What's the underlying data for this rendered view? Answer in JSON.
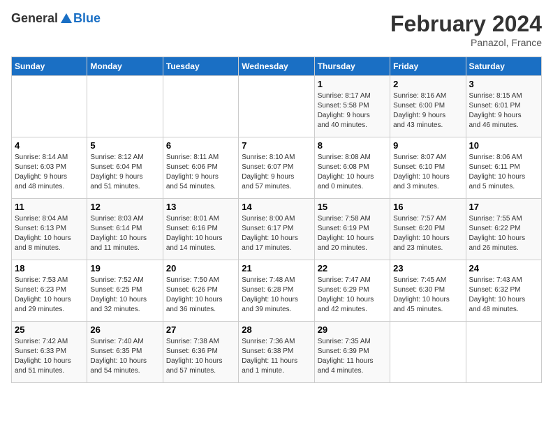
{
  "header": {
    "logo_general": "General",
    "logo_blue": "Blue",
    "month_year": "February 2024",
    "location": "Panazol, France"
  },
  "columns": [
    "Sunday",
    "Monday",
    "Tuesday",
    "Wednesday",
    "Thursday",
    "Friday",
    "Saturday"
  ],
  "weeks": [
    [
      {
        "day": "",
        "info": ""
      },
      {
        "day": "",
        "info": ""
      },
      {
        "day": "",
        "info": ""
      },
      {
        "day": "",
        "info": ""
      },
      {
        "day": "1",
        "info": "Sunrise: 8:17 AM\nSunset: 5:58 PM\nDaylight: 9 hours\nand 40 minutes."
      },
      {
        "day": "2",
        "info": "Sunrise: 8:16 AM\nSunset: 6:00 PM\nDaylight: 9 hours\nand 43 minutes."
      },
      {
        "day": "3",
        "info": "Sunrise: 8:15 AM\nSunset: 6:01 PM\nDaylight: 9 hours\nand 46 minutes."
      }
    ],
    [
      {
        "day": "4",
        "info": "Sunrise: 8:14 AM\nSunset: 6:03 PM\nDaylight: 9 hours\nand 48 minutes."
      },
      {
        "day": "5",
        "info": "Sunrise: 8:12 AM\nSunset: 6:04 PM\nDaylight: 9 hours\nand 51 minutes."
      },
      {
        "day": "6",
        "info": "Sunrise: 8:11 AM\nSunset: 6:06 PM\nDaylight: 9 hours\nand 54 minutes."
      },
      {
        "day": "7",
        "info": "Sunrise: 8:10 AM\nSunset: 6:07 PM\nDaylight: 9 hours\nand 57 minutes."
      },
      {
        "day": "8",
        "info": "Sunrise: 8:08 AM\nSunset: 6:08 PM\nDaylight: 10 hours\nand 0 minutes."
      },
      {
        "day": "9",
        "info": "Sunrise: 8:07 AM\nSunset: 6:10 PM\nDaylight: 10 hours\nand 3 minutes."
      },
      {
        "day": "10",
        "info": "Sunrise: 8:06 AM\nSunset: 6:11 PM\nDaylight: 10 hours\nand 5 minutes."
      }
    ],
    [
      {
        "day": "11",
        "info": "Sunrise: 8:04 AM\nSunset: 6:13 PM\nDaylight: 10 hours\nand 8 minutes."
      },
      {
        "day": "12",
        "info": "Sunrise: 8:03 AM\nSunset: 6:14 PM\nDaylight: 10 hours\nand 11 minutes."
      },
      {
        "day": "13",
        "info": "Sunrise: 8:01 AM\nSunset: 6:16 PM\nDaylight: 10 hours\nand 14 minutes."
      },
      {
        "day": "14",
        "info": "Sunrise: 8:00 AM\nSunset: 6:17 PM\nDaylight: 10 hours\nand 17 minutes."
      },
      {
        "day": "15",
        "info": "Sunrise: 7:58 AM\nSunset: 6:19 PM\nDaylight: 10 hours\nand 20 minutes."
      },
      {
        "day": "16",
        "info": "Sunrise: 7:57 AM\nSunset: 6:20 PM\nDaylight: 10 hours\nand 23 minutes."
      },
      {
        "day": "17",
        "info": "Sunrise: 7:55 AM\nSunset: 6:22 PM\nDaylight: 10 hours\nand 26 minutes."
      }
    ],
    [
      {
        "day": "18",
        "info": "Sunrise: 7:53 AM\nSunset: 6:23 PM\nDaylight: 10 hours\nand 29 minutes."
      },
      {
        "day": "19",
        "info": "Sunrise: 7:52 AM\nSunset: 6:25 PM\nDaylight: 10 hours\nand 32 minutes."
      },
      {
        "day": "20",
        "info": "Sunrise: 7:50 AM\nSunset: 6:26 PM\nDaylight: 10 hours\nand 36 minutes."
      },
      {
        "day": "21",
        "info": "Sunrise: 7:48 AM\nSunset: 6:28 PM\nDaylight: 10 hours\nand 39 minutes."
      },
      {
        "day": "22",
        "info": "Sunrise: 7:47 AM\nSunset: 6:29 PM\nDaylight: 10 hours\nand 42 minutes."
      },
      {
        "day": "23",
        "info": "Sunrise: 7:45 AM\nSunset: 6:30 PM\nDaylight: 10 hours\nand 45 minutes."
      },
      {
        "day": "24",
        "info": "Sunrise: 7:43 AM\nSunset: 6:32 PM\nDaylight: 10 hours\nand 48 minutes."
      }
    ],
    [
      {
        "day": "25",
        "info": "Sunrise: 7:42 AM\nSunset: 6:33 PM\nDaylight: 10 hours\nand 51 minutes."
      },
      {
        "day": "26",
        "info": "Sunrise: 7:40 AM\nSunset: 6:35 PM\nDaylight: 10 hours\nand 54 minutes."
      },
      {
        "day": "27",
        "info": "Sunrise: 7:38 AM\nSunset: 6:36 PM\nDaylight: 10 hours\nand 57 minutes."
      },
      {
        "day": "28",
        "info": "Sunrise: 7:36 AM\nSunset: 6:38 PM\nDaylight: 11 hours\nand 1 minute."
      },
      {
        "day": "29",
        "info": "Sunrise: 7:35 AM\nSunset: 6:39 PM\nDaylight: 11 hours\nand 4 minutes."
      },
      {
        "day": "",
        "info": ""
      },
      {
        "day": "",
        "info": ""
      }
    ]
  ]
}
